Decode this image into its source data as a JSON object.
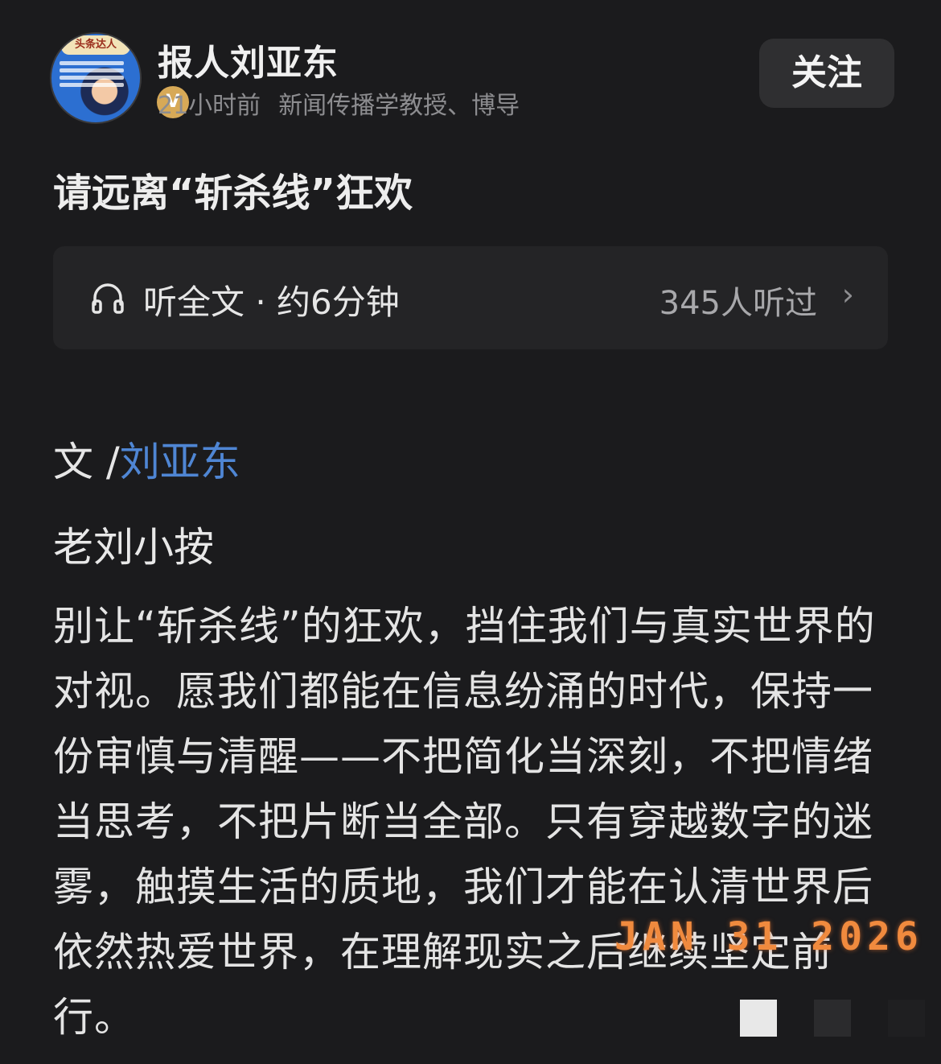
{
  "author": {
    "name": "报人刘亚东",
    "time": "21小时前",
    "description": "新闻传播学教授、博导",
    "verify_badge": "V",
    "avatar_brand": "头条达人"
  },
  "follow_label": "关注",
  "article_title": "请远离“斩杀线”狂欢",
  "listen": {
    "icon": "headphones-icon",
    "label": "听全文 · 约6分钟",
    "count": "345人听过",
    "chevron": "›"
  },
  "byline": {
    "prefix": "文 /",
    "author_link": "刘亚东",
    "link_color": "#4f86d4"
  },
  "subhead": "老刘小按",
  "body": "别让“斩杀线”的狂欢，挡住我们与真实世界的对视。愿我们都能在信息纷涌的时代，保持一份审慎与清醒——不把简化当深刻，不把情绪当思考，不把片断当全部。只有穿越数字的迷雾，触摸生活的质地，我们才能在认清世界后依然热爱世界，在理解现实之后继续坚定前行。",
  "date_stamp": "JAN 31 2026",
  "colors": {
    "background": "#1b1b1d",
    "stamp": "#f08a3e"
  }
}
